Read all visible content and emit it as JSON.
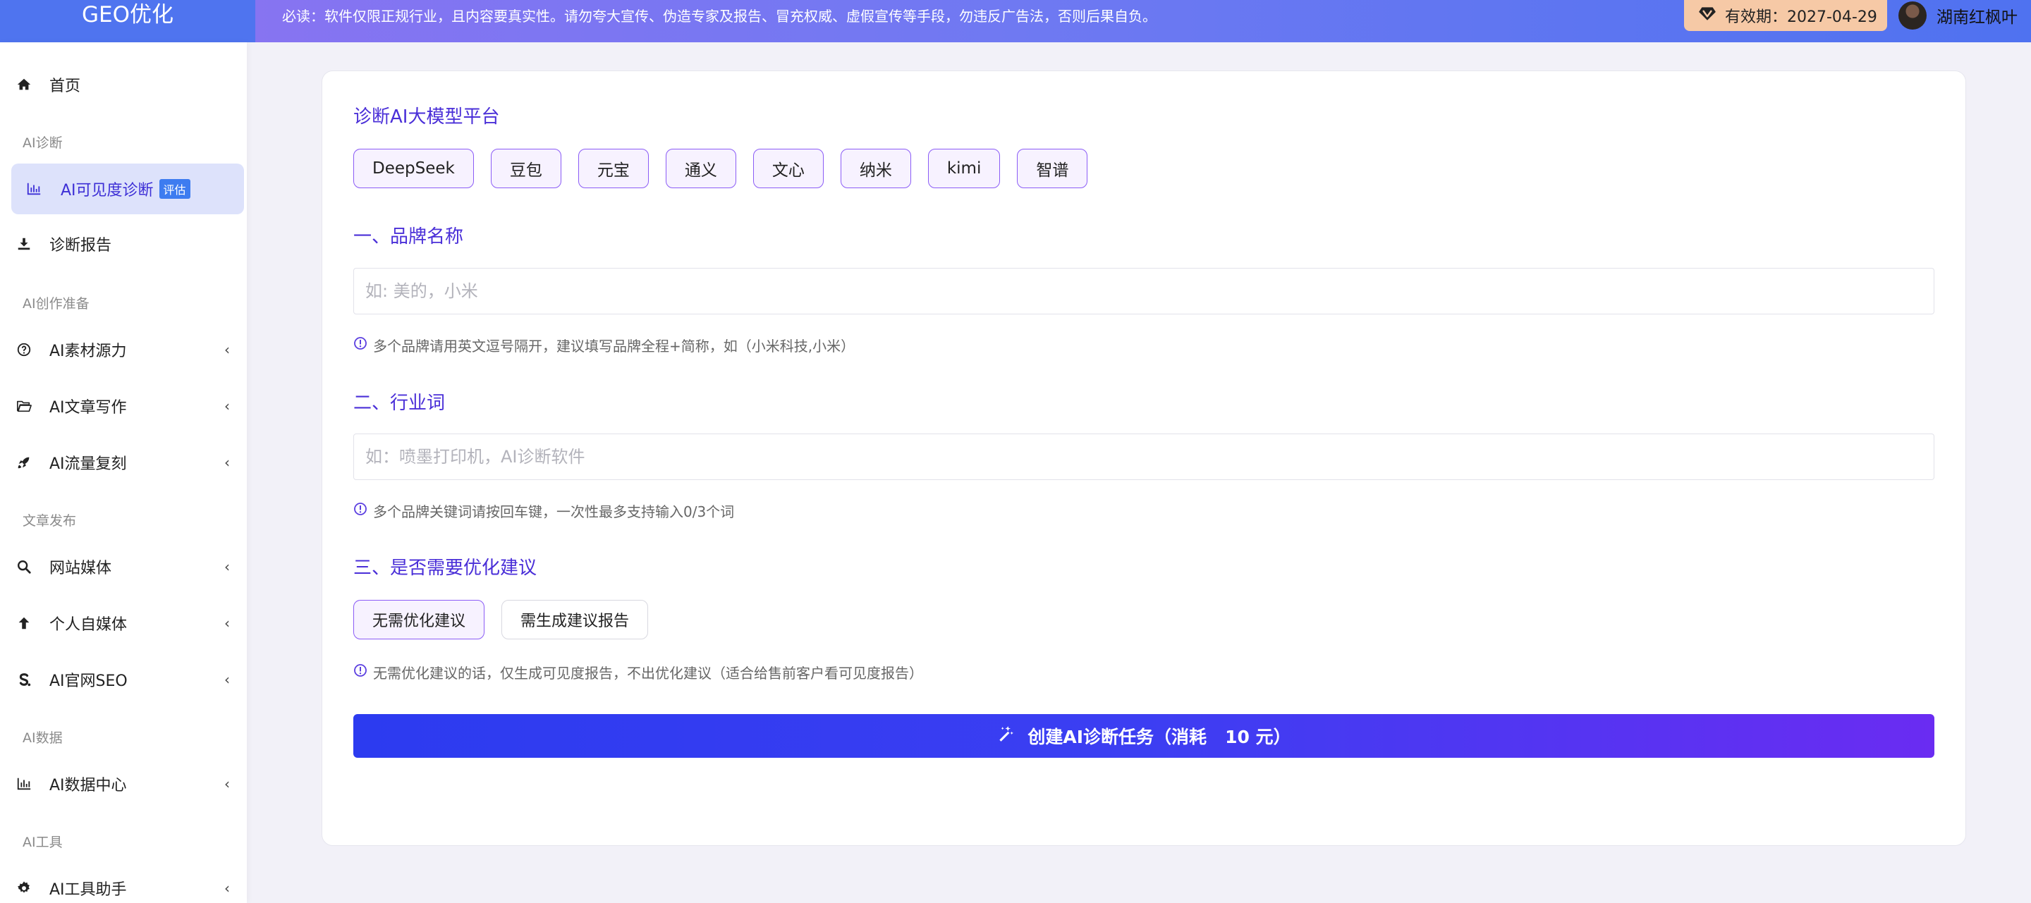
{
  "topbar": {
    "brand": "GEO优化",
    "notice": "必读：软件仅限正规行业，且内容要真实性。请勿夸大宣传、伪造专家及报告、冒充权威、虚假宣传等手段，勿违反广告法，否则后果自负。",
    "expiry": "有效期：2027-04-29",
    "username": "湖南红枫叶"
  },
  "sidebar": {
    "home": "首页",
    "sections": [
      "AI诊断",
      "AI创作准备",
      "文章发布",
      "AI数据",
      "AI工具"
    ],
    "items": [
      {
        "label": "AI可见度诊断",
        "badge": "评估",
        "icon": "bar-chart-icon"
      },
      {
        "label": "诊断报告",
        "icon": "download-icon"
      },
      {
        "label": "AI素材源力",
        "icon": "question-circle-icon"
      },
      {
        "label": "AI文章写作",
        "icon": "folder-open-icon"
      },
      {
        "label": "AI流量复刻",
        "icon": "rocket-icon"
      },
      {
        "label": "网站媒体",
        "icon": "search-icon"
      },
      {
        "label": "个人自媒体",
        "icon": "arrow-up-icon"
      },
      {
        "label": "AI官网SEO",
        "icon": "s-letter-icon"
      },
      {
        "label": "AI数据中心",
        "icon": "bar-chart-icon"
      },
      {
        "label": "AI工具助手",
        "icon": "gear-icon"
      }
    ]
  },
  "main": {
    "platform_heading": "诊断AI大模型平台",
    "platforms": [
      "DeepSeek",
      "豆包",
      "元宝",
      "通义",
      "文心",
      "纳米",
      "kimi",
      "智谱"
    ],
    "brand_heading": "一、品牌名称",
    "brand_placeholder": "如: 美的，小米",
    "brand_hint": "多个品牌请用英文逗号隔开，建议填写品牌全程+简称，如（小米科技,小米）",
    "industry_heading": "二、行业词",
    "industry_placeholder": "如：喷墨打印机，AI诊断软件",
    "industry_hint": "多个品牌关键词请按回车键，一次性最多支持输入0/3个词",
    "advice_heading": "三、是否需要优化建议",
    "advice_options": [
      "无需优化建议",
      "需生成建议报告"
    ],
    "advice_hint": "无需优化建议的话，仅生成可见度报告，不出优化建议（适合给售前客户看可见度报告）",
    "submit_label": "创建AI诊断任务（消耗   10 元）"
  },
  "colors": {
    "accent": "#4a2fd8",
    "chip_border": "#8b5cf6",
    "submit_start": "#2c3bf0",
    "submit_end": "#6a2cf2",
    "expiry_bg": "#f6c9a6"
  }
}
